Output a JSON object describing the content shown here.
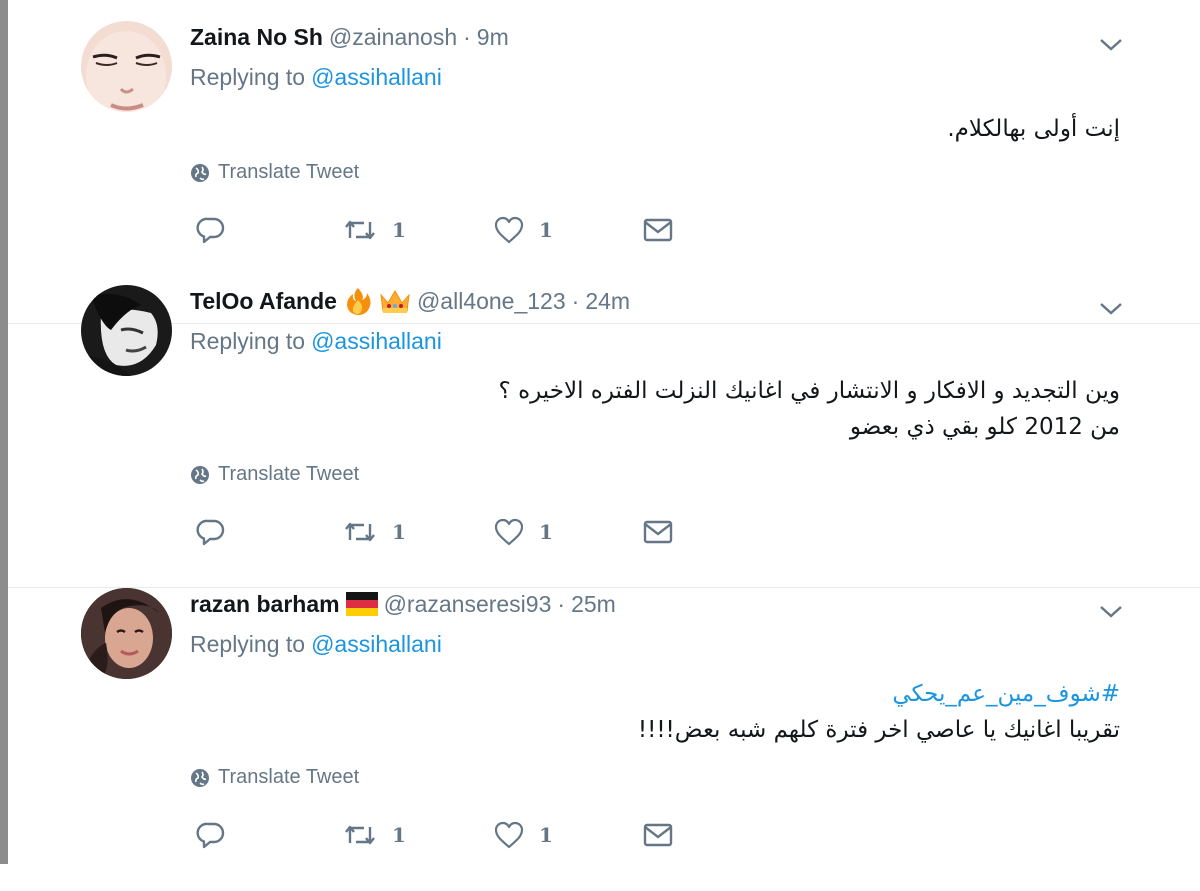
{
  "tweets": [
    {
      "name": "Zaina No Sh",
      "name_emojis": [],
      "handle": "@zainanosh",
      "time": "9m",
      "replying_prefix": "Replying to",
      "replying_to": "@assihallani",
      "hashtag": "",
      "text_lines": [
        "إنت أولى بهالكلام."
      ],
      "translate_label": "Translate Tweet",
      "retweets": "1",
      "likes": "1"
    },
    {
      "name": "TelOo Afande",
      "name_emojis": [
        "fire-emoji",
        "crown-emoji"
      ],
      "handle": "@all4one_123",
      "time": "24m",
      "replying_prefix": "Replying to",
      "replying_to": "@assihallani",
      "hashtag": "",
      "text_lines": [
        "وين التجديد و الافكار و الانتشار في اغانيك النزلت الفتره الاخيره ؟",
        "من 2012 كلو بقي ذي بعضو"
      ],
      "translate_label": "Translate Tweet",
      "retweets": "1",
      "likes": "1"
    },
    {
      "name": "razan barham",
      "name_emojis": [
        "germany-flag-emoji"
      ],
      "handle": "@razanseresi93",
      "time": "25m",
      "replying_prefix": "Replying to",
      "replying_to": "@assihallani",
      "hashtag": "#شوف_مين_عم_يحكي",
      "text_lines": [
        "تقريبا اغانيك يا عاصي اخر فترة كلهم شبه بعض!!!!"
      ],
      "translate_label": "Translate Tweet",
      "retweets": "1",
      "likes": "1"
    }
  ],
  "colors": {
    "link": "#1b95e0",
    "secondary": "#657786",
    "divider": "#e6ecf0",
    "left_bar": "#8c8c8c"
  },
  "icons": [
    "reply-icon",
    "retweet-icon",
    "like-icon",
    "direct-message-icon",
    "globe-icon",
    "chevron-down-icon"
  ]
}
